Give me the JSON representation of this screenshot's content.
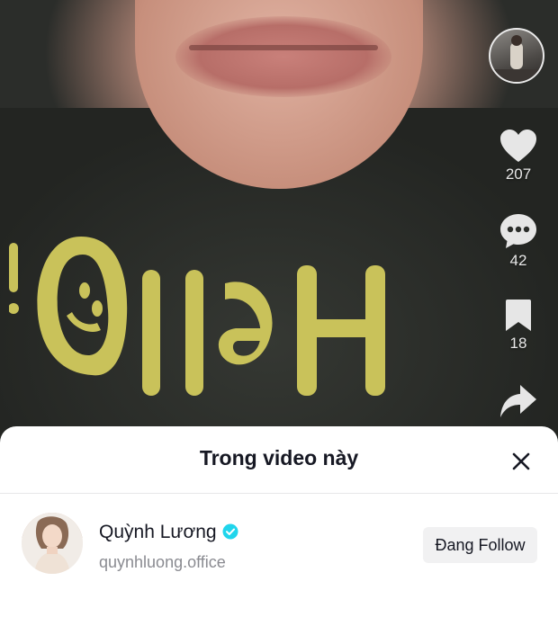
{
  "actions": {
    "likes": "207",
    "comments": "42",
    "saves": "18"
  },
  "sheet": {
    "title": "Trong video này"
  },
  "user": {
    "name": "Quỳnh Lương",
    "handle": "quynhluong.office",
    "follow_label": "Đang Follow",
    "verified": true
  },
  "colors": {
    "sheet_bg": "#ffffff",
    "verified_badge": "#20d5ec",
    "shirt_print": "#c9c25a",
    "follow_button_bg": "#f1f1f2"
  },
  "icons": [
    "heart-icon",
    "comment-icon",
    "bookmark-icon",
    "share-icon",
    "close-icon",
    "verified-badge-icon"
  ]
}
